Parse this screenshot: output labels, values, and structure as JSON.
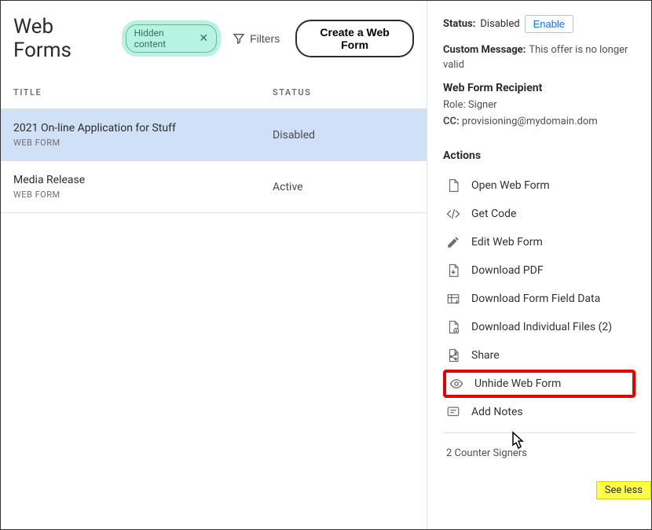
{
  "header": {
    "title": "Web Forms",
    "chip_label": "Hidden content",
    "filters_label": "Filters",
    "create_label": "Create a Web Form"
  },
  "table": {
    "columns": {
      "title": "TITLE",
      "status": "STATUS"
    },
    "rows": [
      {
        "title": "2021 On-line Application for Stuff",
        "sub": "WEB FORM",
        "status": "Disabled",
        "selected": true
      },
      {
        "title": "Media Release",
        "sub": "WEB FORM",
        "status": "Active",
        "selected": false
      }
    ]
  },
  "details": {
    "status_label": "Status:",
    "status_value": "Disabled",
    "enable_label": "Enable",
    "custom_msg_label": "Custom Message:",
    "custom_msg_value": "This offer is no longer valid",
    "recipient_label": "Web Form Recipient",
    "role_label": "Role:",
    "role_value": "Signer",
    "cc_label": "CC:",
    "cc_value": "provisioning@mydomain.dom"
  },
  "actions": {
    "header": "Actions",
    "items": [
      {
        "icon": "file-icon",
        "label": "Open Web Form"
      },
      {
        "icon": "code-icon",
        "label": "Get Code"
      },
      {
        "icon": "pencil-icon",
        "label": "Edit Web Form"
      },
      {
        "icon": "download-pdf-icon",
        "label": "Download PDF"
      },
      {
        "icon": "download-data-icon",
        "label": "Download Form Field Data"
      },
      {
        "icon": "download-files-icon",
        "label": "Download Individual Files (2)"
      },
      {
        "icon": "share-icon",
        "label": "Share"
      },
      {
        "icon": "eye-icon",
        "label": "Unhide Web Form",
        "highlight": true
      },
      {
        "icon": "note-icon",
        "label": "Add Notes"
      }
    ],
    "see_less": "See less"
  },
  "footer": {
    "counter_signers": "2 Counter Signers"
  }
}
